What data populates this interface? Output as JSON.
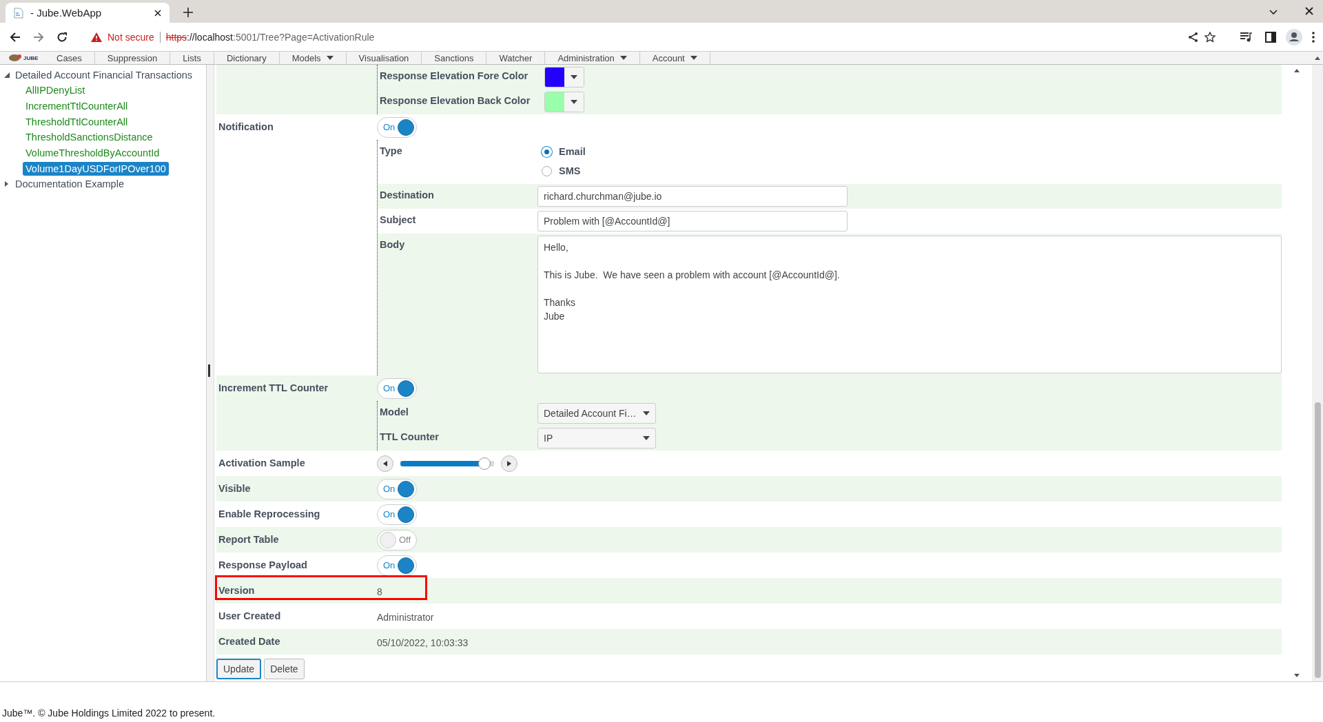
{
  "browser": {
    "tab_title": "- Jube.WebApp",
    "warning": "Not secure",
    "scheme": "https",
    "host": "://localhost",
    "path": ":5001/Tree?Page=ActivationRule"
  },
  "menu": {
    "logo_text": "JUBE",
    "items": [
      {
        "label": "Cases",
        "dropdown": false
      },
      {
        "label": "Suppression",
        "dropdown": false
      },
      {
        "label": "Lists",
        "dropdown": false
      },
      {
        "label": "Dictionary",
        "dropdown": false
      },
      {
        "label": "Models",
        "dropdown": true
      },
      {
        "label": "Visualisation",
        "dropdown": false
      },
      {
        "label": "Sanctions",
        "dropdown": false
      },
      {
        "label": "Watcher",
        "dropdown": false
      },
      {
        "label": "Administration",
        "dropdown": true
      },
      {
        "label": "Account",
        "dropdown": true
      }
    ]
  },
  "tree": [
    {
      "label": "Detailed Account Financial Transactions",
      "expanded": true,
      "children": [
        {
          "label": "AllIPDenyList",
          "selected": false
        },
        {
          "label": "IncrementTtlCounterAll",
          "selected": false
        },
        {
          "label": "ThresholdTtlCounterAll",
          "selected": false
        },
        {
          "label": "ThresholdSanctionsDistance",
          "selected": false
        },
        {
          "label": "VolumeThresholdByAccountId",
          "selected": false
        },
        {
          "label": "Volume1DayUSDForIPOver100",
          "selected": true
        }
      ]
    },
    {
      "label": "Documentation Example",
      "expanded": false
    }
  ],
  "fields": [
    {
      "kind": "group",
      "sub": [
        {
          "label": "Response Elevation Fore Color",
          "kind": "color",
          "color": "#2200ff"
        },
        {
          "label": "Response Elevation Back Color",
          "kind": "color",
          "color": "#99ffaa"
        }
      ]
    },
    {
      "label": "Notification",
      "kind": "toggle",
      "on": true,
      "text": "On",
      "sub": [
        {
          "label": "Type",
          "kind": "radio",
          "options": [
            {
              "label": "Email",
              "selected": true
            },
            {
              "label": "SMS",
              "selected": false
            }
          ]
        },
        {
          "label": "Destination",
          "kind": "input",
          "value": "richard.churchman@jube.io"
        },
        {
          "label": "Subject",
          "kind": "input",
          "value": "Problem with [@AccountId@]"
        },
        {
          "label": "Body",
          "kind": "textarea",
          "value": "Hello,\n\nThis is Jube.  We have seen a problem with account [@AccountId@].\n\nThanks\nJube"
        }
      ]
    },
    {
      "label": "Increment TTL Counter",
      "kind": "toggle",
      "on": true,
      "text": "On",
      "sub": [
        {
          "label": "Model",
          "kind": "select",
          "value": "Detailed Account Fi…"
        },
        {
          "label": "TTL Counter",
          "kind": "select",
          "value": "IP"
        }
      ]
    },
    {
      "label": "Activation Sample",
      "kind": "slider",
      "level": 0.96
    },
    {
      "label": "Visible",
      "kind": "toggle",
      "on": true,
      "text": "On"
    },
    {
      "label": "Enable Reprocessing",
      "kind": "toggle",
      "on": true,
      "text": "On"
    },
    {
      "label": "Report Table",
      "kind": "toggle",
      "on": false,
      "text": "Off"
    },
    {
      "label": "Response Payload",
      "kind": "toggle",
      "on": true,
      "text": "On"
    },
    {
      "label": "Version",
      "kind": "text",
      "value": "8",
      "highlighted": true
    },
    {
      "label": "User Created",
      "kind": "text",
      "value": "Administrator"
    },
    {
      "label": "Created Date",
      "kind": "text",
      "value": "05/10/2022, 10:03:33"
    }
  ],
  "buttons": [
    {
      "label": "Update",
      "focused": true
    },
    {
      "label": "Delete",
      "focused": false
    }
  ],
  "footer": "Jube™. © Jube Holdings Limited 2022 to present."
}
